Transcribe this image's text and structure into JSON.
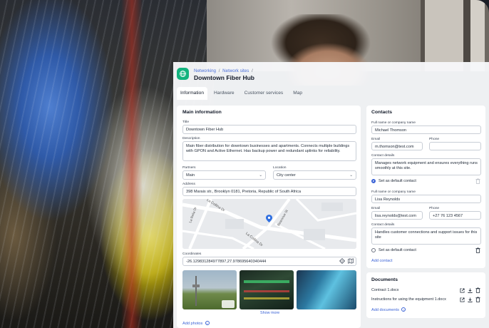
{
  "breadcrumb": {
    "items": [
      "Networking",
      "Network sites"
    ],
    "separator": "/"
  },
  "page": {
    "title": "Downtown Fiber Hub"
  },
  "tabs": [
    {
      "label": "Information",
      "active": true
    },
    {
      "label": "Hardware",
      "active": false
    },
    {
      "label": "Customer services",
      "active": false
    },
    {
      "label": "Map",
      "active": false
    }
  ],
  "main": {
    "heading": "Main information",
    "title_label": "Title",
    "title_value": "Downtown Fiber Hub",
    "description_label": "Description",
    "description_value": "Main fiber distribution for downtown businesses and apartments. Connects multiple buildings with GPON and Active Ethernet. Has backup power and redundant uplinks for reliability.",
    "partners_label": "Partners",
    "partners_value": "Main",
    "location_label": "Location",
    "location_value": "City center",
    "address_label": "Address",
    "address_value": "398 Marais str., Brooklyn 0181, Pretoria, Republic of South Africa",
    "map_streets": [
      "La Collina Dr",
      "La Relia Dr",
      "Bearsrive St",
      "La Collina Dr"
    ],
    "coordinates_label": "Coordinates",
    "coordinates_value": "-26.129831284977897,27.978695640340444",
    "show_more": "Show more",
    "add_photos": "Add photos"
  },
  "contacts": {
    "heading": "Contacts",
    "items": [
      {
        "name_label": "Full name or company name",
        "name": "Michael Thomson",
        "email_label": "Email",
        "email": "m.thomson@test.com",
        "phone_label": "Phone",
        "phone": "",
        "details_label": "Contact details",
        "details": "Manages network equipment and ensures everything runs smoothly at this site.",
        "default_label": "Set as default contact",
        "is_default": true
      },
      {
        "name_label": "Full name or company name",
        "name": "Lisa Reynolds",
        "email_label": "Email",
        "email": "lisa.reynolds@test.com",
        "phone_label": "Phone",
        "phone": "+27 76 123 4567",
        "details_label": "Contact details",
        "details": "Handles customer connections and support issues for this site",
        "default_label": "Set as default contact",
        "is_default": false
      }
    ],
    "add_label": "Add contact"
  },
  "documents": {
    "heading": "Documents",
    "items": [
      {
        "name": "Contract 1.docx"
      },
      {
        "name": "Instructions for using the equipment 1.docx"
      }
    ],
    "add_label": "Add documents"
  },
  "colors": {
    "accent": "#3b63d6",
    "brand_icon": "#13b37e",
    "map_pin": "#2f6fe0"
  },
  "icons": [
    "network-icon",
    "chevron-down-icon",
    "target-icon",
    "map-icon",
    "info-icon",
    "trash-icon",
    "external-link-icon",
    "download-icon"
  ]
}
